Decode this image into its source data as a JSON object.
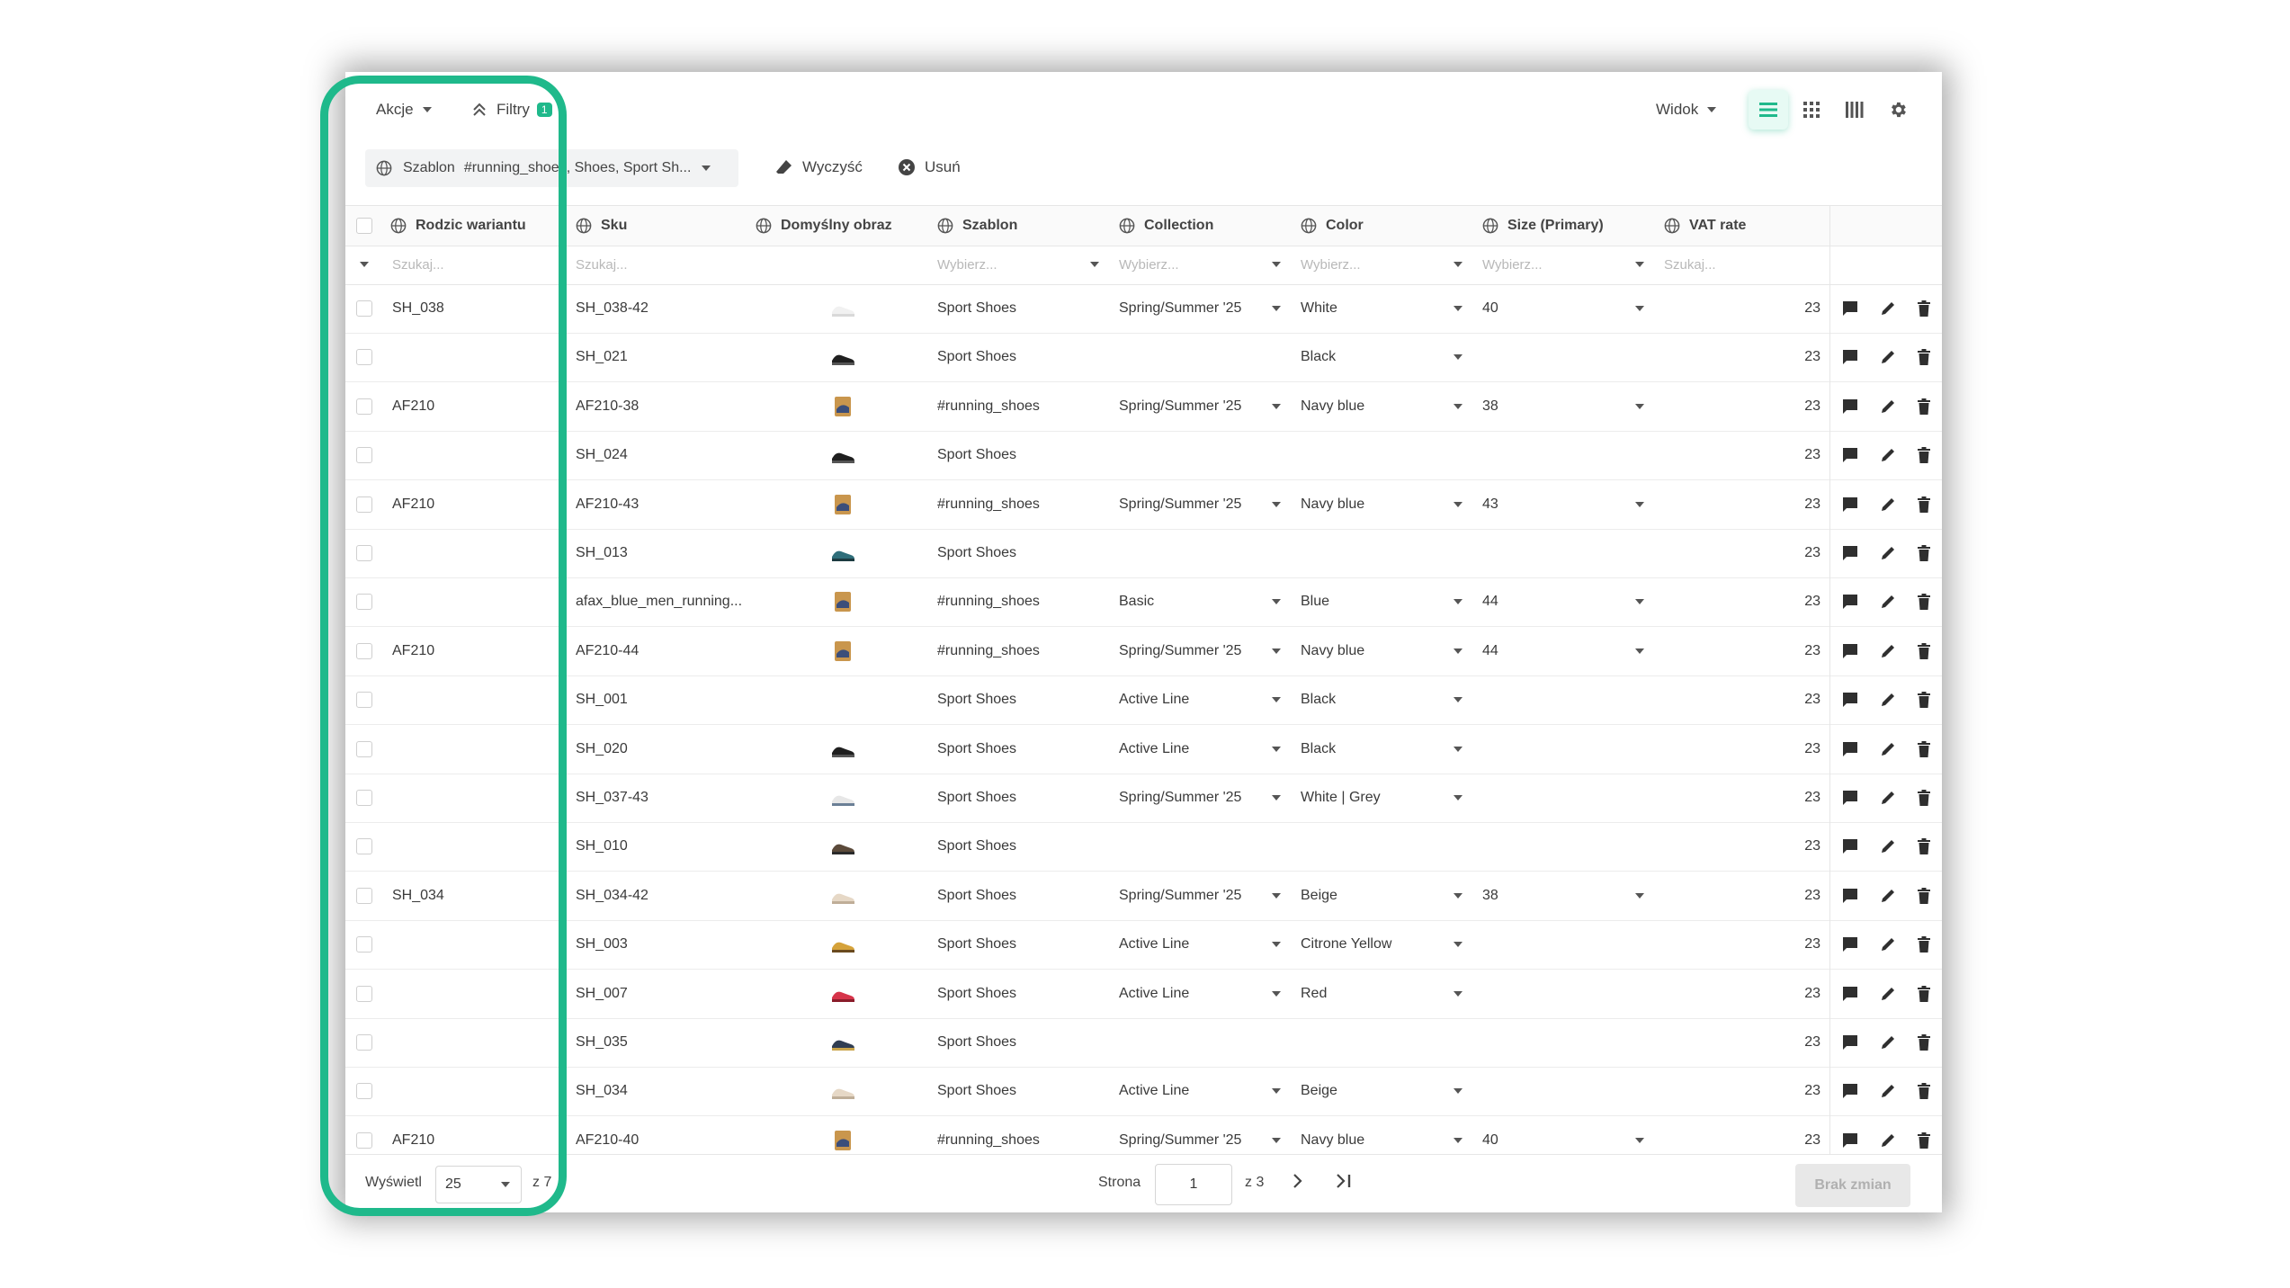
{
  "toolbar": {
    "actions_label": "Akcje",
    "filters_label": "Filtry",
    "filters_count": "1",
    "view_label": "Widok",
    "chip_label": "Szablon",
    "chip_value": "#running_shoes, Shoes, Sport Sh...",
    "clear_label": "Wyczyść",
    "remove_label": "Usuń"
  },
  "columns": {
    "parent": "Rodzic wariantu",
    "sku": "Sku",
    "image": "Domyślny obraz",
    "template": "Szablon",
    "collection": "Collection",
    "color": "Color",
    "size": "Size (Primary)",
    "vat": "VAT rate"
  },
  "filters": {
    "search": "Szukaj...",
    "choose": "Wybierz..."
  },
  "rows": [
    {
      "parent": "SH_038",
      "sku": "SH_038-42",
      "thumb": "white-shoe",
      "template": "Sport Shoes",
      "collection": "Spring/Summer '25",
      "color": "White",
      "size": "40",
      "vat": "23"
    },
    {
      "parent": "",
      "sku": "SH_021",
      "thumb": "black-shoe",
      "template": "Sport Shoes",
      "collection": "",
      "color": "Black",
      "size": "",
      "vat": "23"
    },
    {
      "parent": "AF210",
      "sku": "AF210-38",
      "thumb": "boxed-shoe",
      "template": "#running_shoes",
      "collection": "Spring/Summer '25",
      "color": "Navy blue",
      "size": "38",
      "vat": "23"
    },
    {
      "parent": "",
      "sku": "SH_024",
      "thumb": "black-shoe",
      "template": "Sport Shoes",
      "collection": "",
      "color": "",
      "size": "",
      "vat": "23"
    },
    {
      "parent": "AF210",
      "sku": "AF210-43",
      "thumb": "boxed-shoe",
      "template": "#running_shoes",
      "collection": "Spring/Summer '25",
      "color": "Navy blue",
      "size": "43",
      "vat": "23"
    },
    {
      "parent": "",
      "sku": "SH_013",
      "thumb": "teal-shoe",
      "template": "Sport Shoes",
      "collection": "",
      "color": "",
      "size": "",
      "vat": "23"
    },
    {
      "parent": "",
      "sku": "afax_blue_men_running...",
      "thumb": "boxed-shoe",
      "template": "#running_shoes",
      "collection": "Basic",
      "color": "Blue",
      "size": "44",
      "vat": "23"
    },
    {
      "parent": "AF210",
      "sku": "AF210-44",
      "thumb": "boxed-shoe",
      "template": "#running_shoes",
      "collection": "Spring/Summer '25",
      "color": "Navy blue",
      "size": "44",
      "vat": "23"
    },
    {
      "parent": "",
      "sku": "SH_001",
      "thumb": "",
      "template": "Sport Shoes",
      "collection": "Active Line",
      "color": "Black",
      "size": "",
      "vat": "23"
    },
    {
      "parent": "",
      "sku": "SH_020",
      "thumb": "black-shoe",
      "template": "Sport Shoes",
      "collection": "Active Line",
      "color": "Black",
      "size": "",
      "vat": "23"
    },
    {
      "parent": "",
      "sku": "SH_037-43",
      "thumb": "white-grey-shoe",
      "template": "Sport Shoes",
      "collection": "Spring/Summer '25",
      "color": "White | Grey",
      "size": "",
      "vat": "23"
    },
    {
      "parent": "",
      "sku": "SH_010",
      "thumb": "brown-shoe",
      "template": "Sport Shoes",
      "collection": "",
      "color": "",
      "size": "",
      "vat": "23"
    },
    {
      "parent": "SH_034",
      "sku": "SH_034-42",
      "thumb": "beige-shoe",
      "template": "Sport Shoes",
      "collection": "Spring/Summer '25",
      "color": "Beige",
      "size": "38",
      "vat": "23"
    },
    {
      "parent": "",
      "sku": "SH_003",
      "thumb": "yellow-shoe",
      "template": "Sport Shoes",
      "collection": "Active Line",
      "color": "Citrone Yellow",
      "size": "",
      "vat": "23"
    },
    {
      "parent": "",
      "sku": "SH_007",
      "thumb": "red-shoe",
      "template": "Sport Shoes",
      "collection": "Active Line",
      "color": "Red",
      "size": "",
      "vat": "23"
    },
    {
      "parent": "",
      "sku": "SH_035",
      "thumb": "dark-shoe",
      "template": "Sport Shoes",
      "collection": "",
      "color": "",
      "size": "",
      "vat": "23"
    },
    {
      "parent": "",
      "sku": "SH_034",
      "thumb": "beige-shoe",
      "template": "Sport Shoes",
      "collection": "Active Line",
      "color": "Beige",
      "size": "",
      "vat": "23"
    },
    {
      "parent": "AF210",
      "sku": "AF210-40",
      "thumb": "boxed-shoe",
      "template": "#running_shoes",
      "collection": "Spring/Summer '25",
      "color": "Navy blue",
      "size": "40",
      "vat": "23"
    }
  ],
  "footer": {
    "show_label": "Wyświetl",
    "per_page": "25",
    "of_label": "z 7",
    "page_label": "Strona",
    "page_value": "1",
    "page_total": "z 3",
    "save_label": "Brak zmian"
  },
  "colors": {
    "accent": "#1fb98b"
  }
}
